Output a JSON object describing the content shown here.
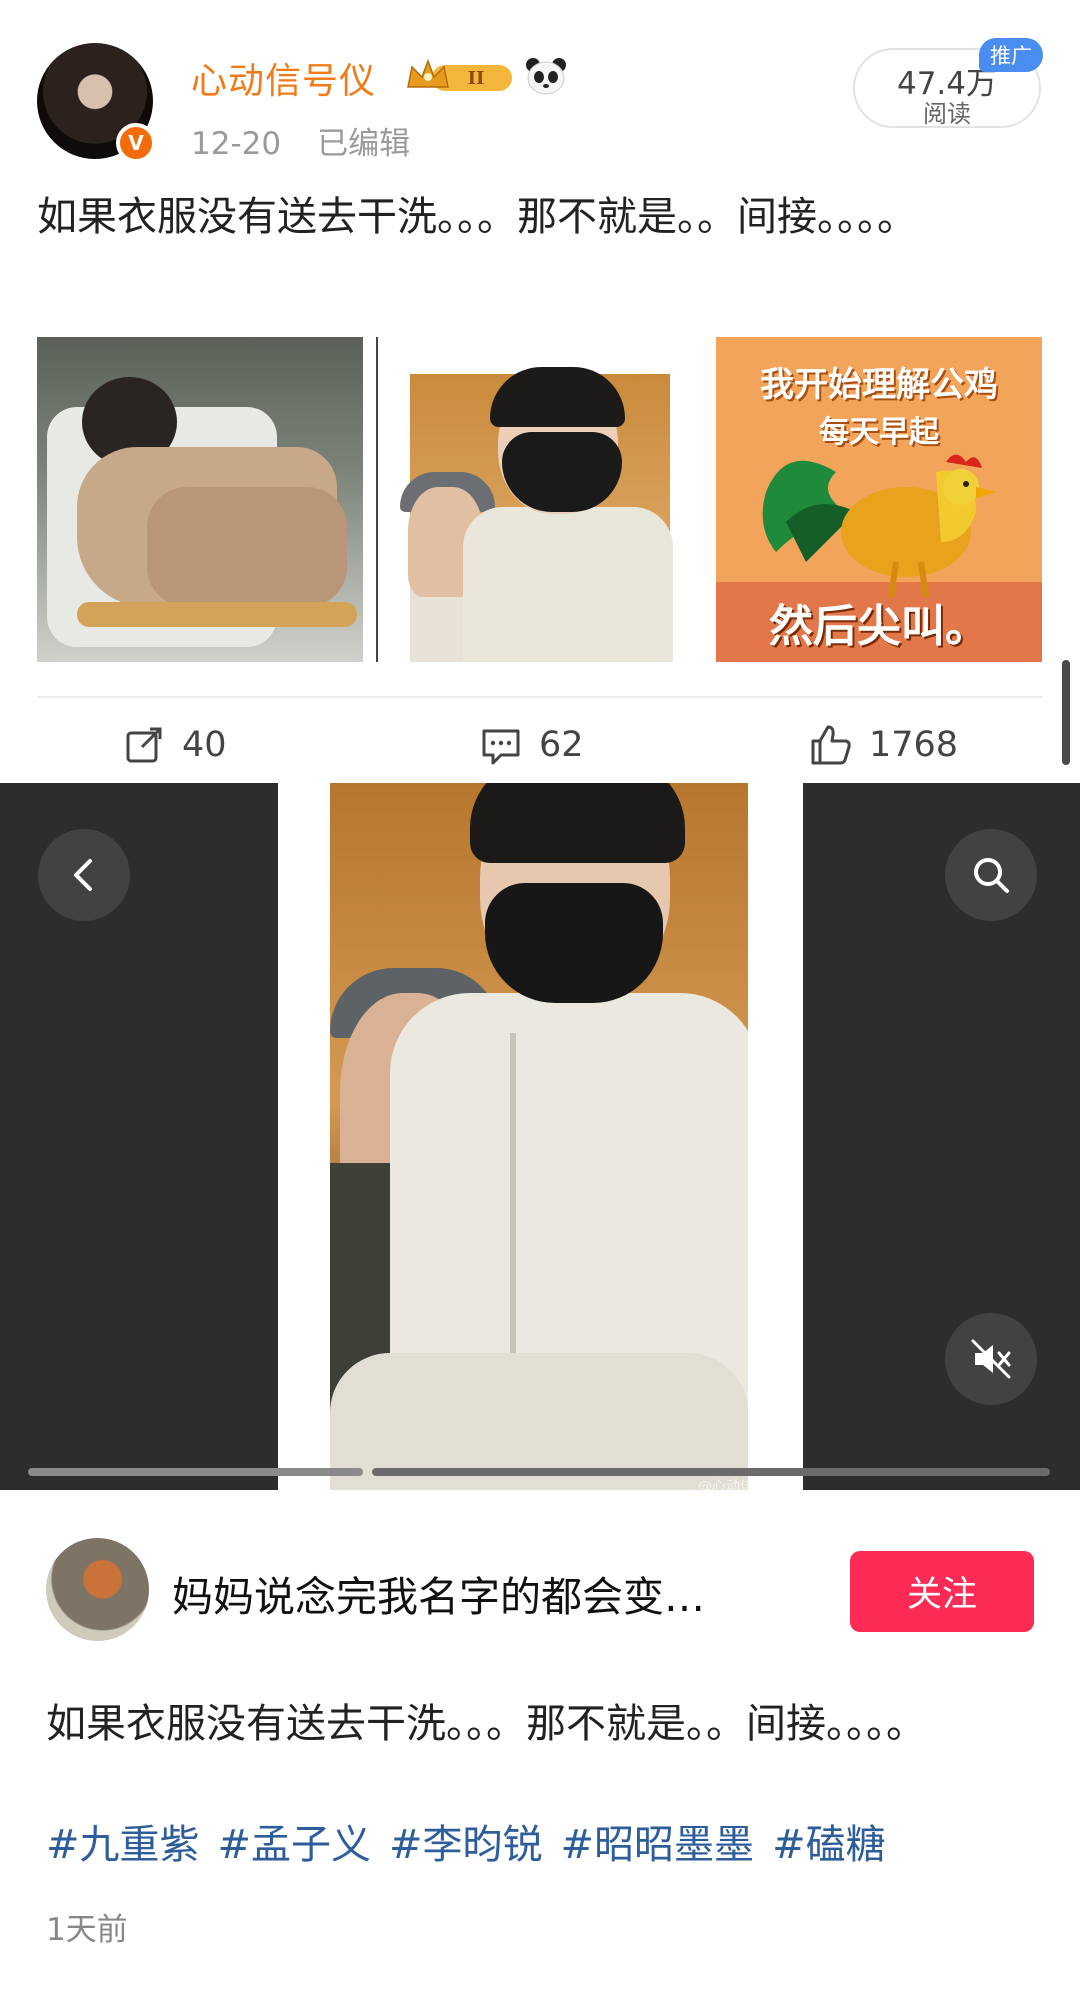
{
  "weibo_post": {
    "username": "心动信号仪",
    "level_badge": "II",
    "verified_badge": "V",
    "date": "12-20",
    "edited_label": "已编辑",
    "reads_count": "47.4万",
    "reads_label": "阅读",
    "ad_badge": "推广",
    "text": "如果衣服没有送去干洗。。。那不就是。。间接。。。。",
    "thumbnails": [
      {
        "alt": "photo-blanket"
      },
      {
        "alt": "photo-masked-man"
      },
      {
        "alt": "meme-rooster",
        "title_line1": "我开始理解公鸡",
        "title_line2": "每天早起",
        "bottom_text": "然后尖叫。"
      }
    ],
    "actions": {
      "repost_count": "40",
      "comment_count": "62",
      "like_count": "1768"
    }
  },
  "viewer": {
    "watermark": "@心动信号仪",
    "icons": {
      "back": "chevron-left-icon",
      "search": "search-icon",
      "mute": "mute-icon"
    },
    "progress_segments": 2
  },
  "second_post": {
    "username": "妈妈说念完我名字的都会变…",
    "follow_label": "关注",
    "text": "如果衣服没有送去干洗。。。那不就是。。间接。。。。",
    "tags": [
      "#九重紫",
      "#孟子义",
      "#李昀锐",
      "#昭昭墨墨",
      "#磕糖"
    ],
    "time_ago": "1天前"
  },
  "colors": {
    "username_orange": "#f07b18",
    "follow_red": "#fc2b55",
    "tag_blue": "#2d5d9a",
    "ad_blue": "#4a8df0"
  }
}
